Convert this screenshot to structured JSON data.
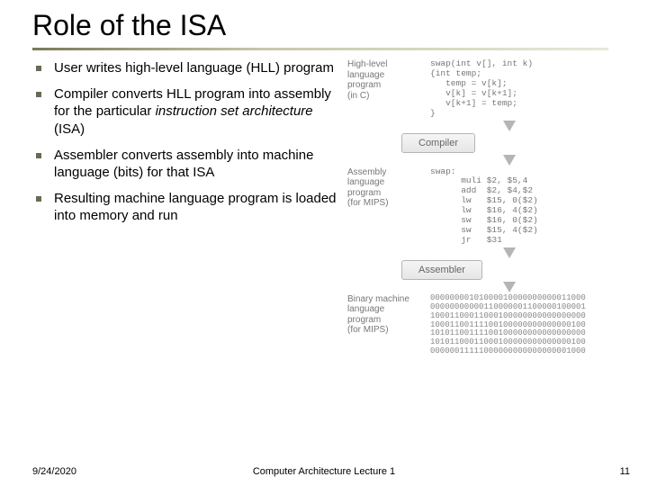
{
  "title": "Role of the ISA",
  "bullets": [
    {
      "pre": "User writes high-level language (HLL) program",
      "italic": "",
      "post": ""
    },
    {
      "pre": "Compiler converts HLL program into assembly for the particular ",
      "italic": "instruction set architecture",
      "post": " (ISA)"
    },
    {
      "pre": "Assembler converts assembly into machine language (bits) for that ISA",
      "italic": "",
      "post": ""
    },
    {
      "pre": "Resulting machine language program is loaded into memory and run",
      "italic": "",
      "post": ""
    }
  ],
  "diagram": {
    "hll_label": "High-level\nlanguage\nprogram\n(in C)",
    "hll_code": "swap(int v[], int k)\n{int temp;\n   temp = v[k];\n   v[k] = v[k+1];\n   v[k+1] = temp;\n}",
    "compiler": "Compiler",
    "asm_label": "Assembly\nlanguage\nprogram\n(for MIPS)",
    "asm_code": "swap:\n      muli $2, $5,4\n      add  $2, $4,$2\n      lw   $15, 0($2)\n      lw   $16, 4($2)\n      sw   $16, 0($2)\n      sw   $15, 4($2)\n      jr   $31",
    "assembler": "Assembler",
    "bin_label": "Binary machine\nlanguage\nprogram\n(for MIPS)",
    "bin_code": "00000000101000010000000000011000\n00000000000110000001100000100001\n10001100011000100000000000000000\n10001100111100100000000000000100\n10101100111100100000000000000000\n10101100011000100000000000000100\n00000011111000000000000000001000"
  },
  "footer": {
    "date": "9/24/2020",
    "mid": "Computer Architecture Lecture 1",
    "num": "11"
  }
}
